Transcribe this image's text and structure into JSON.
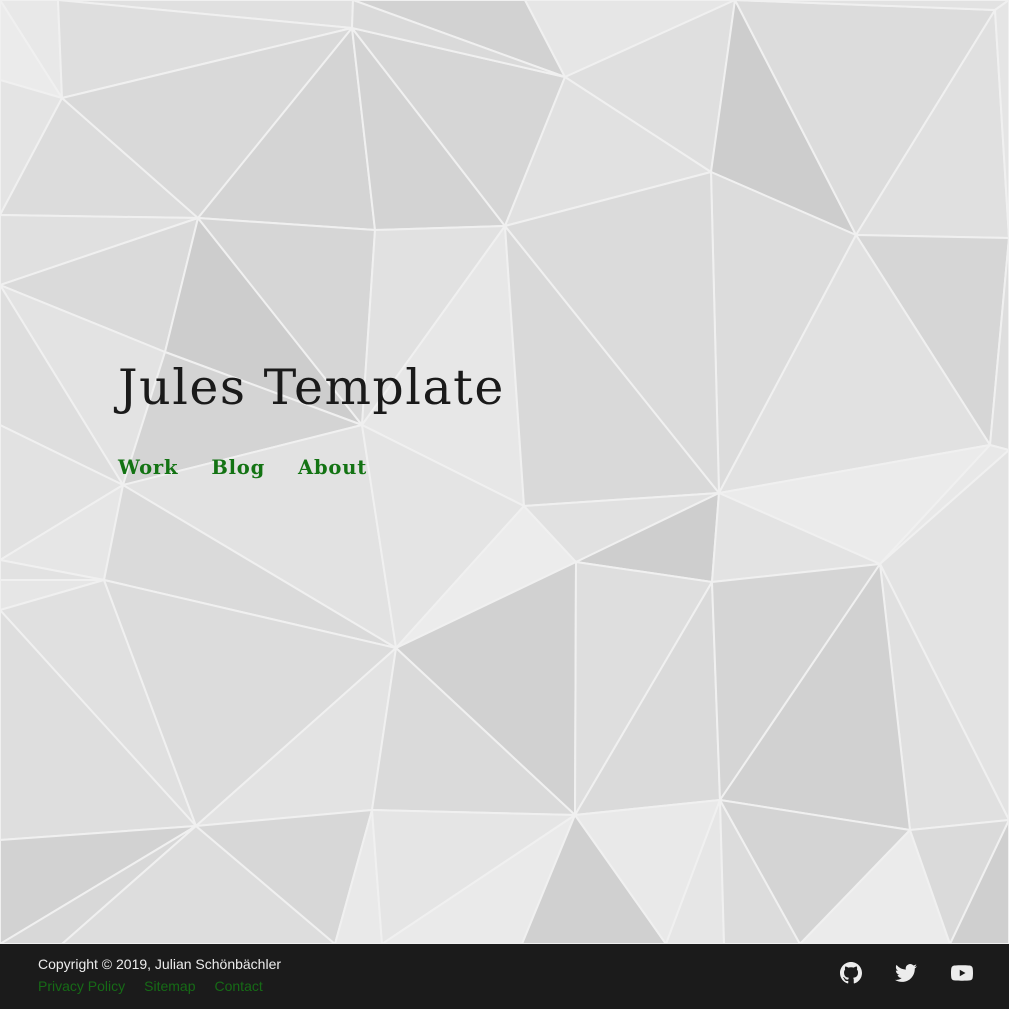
{
  "site": {
    "title": "Jules Template"
  },
  "nav": {
    "items": [
      {
        "label": "Work"
      },
      {
        "label": "Blog"
      },
      {
        "label": "About"
      }
    ]
  },
  "footer": {
    "copyright": "Copyright © 2019, Julian Schönbächler",
    "links": [
      {
        "label": "Privacy Policy"
      },
      {
        "label": "Sitemap"
      },
      {
        "label": "Contact"
      }
    ],
    "social": [
      {
        "icon": "github-icon"
      },
      {
        "icon": "twitter-icon"
      },
      {
        "icon": "youtube-icon"
      }
    ]
  },
  "colors": {
    "link_green": "#137313",
    "footer_bg": "#1b1b1b",
    "background_gray": "#e2e2e2"
  }
}
